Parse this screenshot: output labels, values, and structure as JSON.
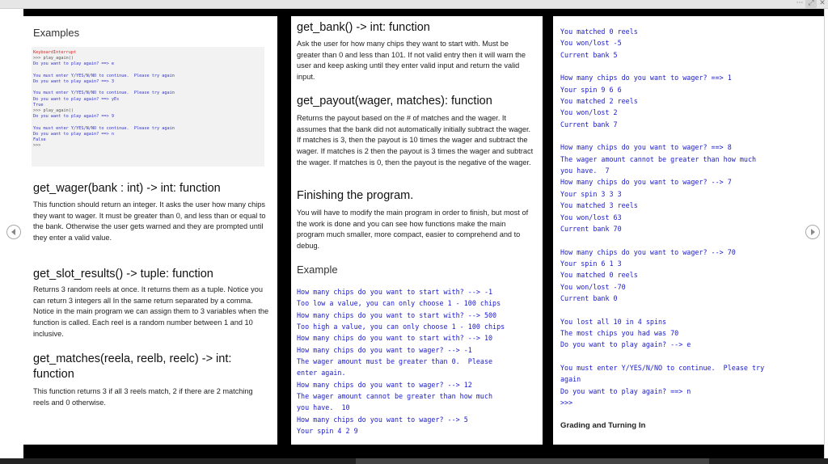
{
  "window": {
    "more_label": "···",
    "maximize_label": "⤢",
    "close_label": "✕"
  },
  "page1": {
    "examples_heading": "Examples",
    "idle_output": [
      {
        "text": "KeyboardInterrupt",
        "style": "red"
      },
      {
        "text": ">>> play_again()",
        "style": "blk"
      },
      {
        "text": "Do you want to play again? ==> e",
        "style": "blue"
      },
      {
        "text": "",
        "style": "blue"
      },
      {
        "text": "You must enter Y/YES/N/NO to continue.  Please try again",
        "style": "blue"
      },
      {
        "text": "Do you want to play again? ==> 3",
        "style": "blue"
      },
      {
        "text": "",
        "style": "blue"
      },
      {
        "text": "You must enter Y/YES/N/NO to continue.  Please try again",
        "style": "blue"
      },
      {
        "text": "Do you want to play again? ==> yEs",
        "style": "blue"
      },
      {
        "text": "True",
        "style": "blue"
      },
      {
        "text": ">>> play_again()",
        "style": "blk"
      },
      {
        "text": "Do you want to play again? ==> 9",
        "style": "blue"
      },
      {
        "text": "",
        "style": "blue"
      },
      {
        "text": "You must enter Y/YES/N/NO to continue.  Please try again",
        "style": "blue"
      },
      {
        "text": "Do you want to play again? ==> n",
        "style": "blue"
      },
      {
        "text": "False",
        "style": "blue"
      },
      {
        "text": ">>>",
        "style": "blk"
      }
    ],
    "get_wager_heading": "get_wager(bank : int) -> int: function",
    "get_wager_text": "This function should return an integer.  It asks the user how many chips they want to wager. It must be greater than 0, and less than or equal to the bank. Otherwise the user gets warned and they are prompted until they enter a valid value.",
    "get_slot_heading": "get_slot_results() -> tuple: function",
    "get_slot_text": "Returns 3 random reels at once.  It returns them as a tuple.  Notice you can return 3 integers all In the same return separated by a comma.  Notice in the main program we can assign them to 3 variables when the function is called.  Each reel is a random number between 1 and 10 inclusive.",
    "get_matches_heading": "get_matches(reela, reelb, reelc) -> int: function",
    "get_matches_text": "This function returns 3 if all 3 reels match, 2 if there are 2 matching reels and 0 otherwise."
  },
  "page2": {
    "get_bank_heading": "get_bank() -> int: function",
    "get_bank_text": "Ask the user for how many chips they want to start with.  Must be greater than 0 and less than 101.  If not valid entry then it will warn the user and keep asking until they enter valid input and return the valid input.",
    "get_payout_heading": "get_payout(wager, matches): function",
    "get_payout_text": "Returns the payout based on the # of matches and the wager. It assumes that the bank did not automatically initially subtract the wager.  If matches is 3, then the payout is 10 times the wager and subtract the wager.  If matches is 2 then the payout is 3 times the wager and subtract the wager.  If matches is 0, then the payout is the negative of the wager.",
    "finishing_heading": "Finishing the program.",
    "finishing_text": "You will have to modify the main program in order to finish, but most of the work is done and you can see how functions make the main program much smaller, more compact, easier to comprehend and to debug.",
    "example_heading": "Example",
    "example_output": "How many chips do you want to start with? --> -1\nToo low a value, you can only choose 1 - 100 chips\nHow many chips do you want to start with? --> 500\nToo high a value, you can only choose 1 - 100 chips\nHow many chips do you want to start with? --> 10\nHow many chips do you want to wager? --> -1\nThe wager amount must be greater than 0.  Please\nenter again.\nHow many chips do you want to wager? --> 12\nThe wager amount cannot be greater than how much\nyou have.  10\nHow many chips do you want to wager? --> 5\nYour spin 4 2 9"
  },
  "page3": {
    "example_output": "You matched 0 reels\nYou won/lost -5\nCurrent bank 5\n\nHow many chips do you want to wager? ==> 1\nYour spin 9 6 6\nYou matched 2 reels\nYou won/lost 2\nCurrent bank 7\n\nHow many chips do you want to wager? ==> 8\nThe wager amount cannot be greater than how much\nyou have.  7\nHow many chips do you want to wager? --> 7\nYour spin 3 3 3\nYou matched 3 reels\nYou won/lost 63\nCurrent bank 70\n\nHow many chips do you want to wager? --> 70\nYour spin 6 1 3\nYou matched 0 reels\nYou won/lost -70\nCurrent bank 0\n\nYou lost all 10 in 4 spins\nThe most chips you had was 70\nDo you want to play again? --> e\n\nYou must enter Y/YES/N/NO to continue.  Please try\nagain\nDo you want to play again? ==> n\n>>>",
    "grading_heading": "Grading and Turning In"
  },
  "navigation": {
    "prev_label": "previous-page",
    "next_label": "next-page"
  }
}
